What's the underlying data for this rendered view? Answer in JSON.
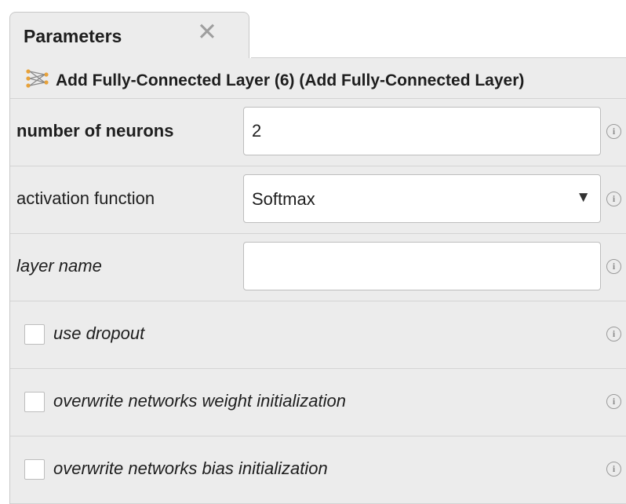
{
  "tab": {
    "title": "Parameters",
    "close_glyph": "✕"
  },
  "operator": {
    "icon": "neural-layer-icon",
    "title": "Add Fully-Connected Layer (6) (Add Fully-Connected Layer)"
  },
  "params": {
    "number_of_neurons": {
      "label": "number of neurons",
      "value": "2"
    },
    "activation_function": {
      "label": "activation function",
      "value": "Softmax",
      "arrow": "▼"
    },
    "layer_name": {
      "label": "layer name",
      "value": ""
    },
    "use_dropout": {
      "label": "use dropout",
      "checked": false
    },
    "overwrite_weight_init": {
      "label": "overwrite networks weight initialization",
      "checked": false
    },
    "overwrite_bias_init": {
      "label": "overwrite networks bias initialization",
      "checked": false
    }
  },
  "info_glyph": "i",
  "colors": {
    "panel_bg": "#ececec",
    "icon_orange": "#e8a23a",
    "icon_gray": "#8a8a8a"
  }
}
